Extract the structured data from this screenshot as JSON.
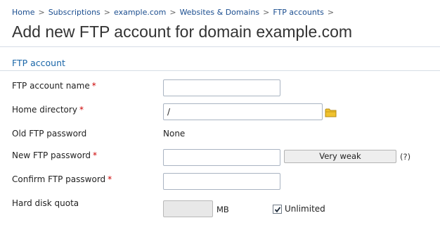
{
  "breadcrumb": {
    "items": [
      "Home",
      "Subscriptions",
      "example.com",
      "Websites & Domains",
      "FTP accounts"
    ],
    "separator": ">"
  },
  "page_title": "Add new FTP account for domain example.com",
  "section_title": "FTP account",
  "required_marker": "*",
  "form": {
    "account_name": {
      "label": "FTP account name",
      "value": ""
    },
    "home_directory": {
      "label": "Home directory",
      "value": "/"
    },
    "old_password": {
      "label": "Old FTP password",
      "value": "None"
    },
    "new_password": {
      "label": "New FTP password",
      "value": "",
      "strength": "Very weak",
      "help": "(?)"
    },
    "confirm_password": {
      "label": "Confirm FTP password",
      "value": ""
    },
    "disk_quota": {
      "label": "Hard disk quota",
      "value": "",
      "unit": "MB",
      "unlimited_label": "Unlimited",
      "unlimited_checked": true
    }
  },
  "icons": {
    "browse": "folder-icon"
  },
  "colors": {
    "link": "#1a4d8f",
    "section": "#1a66a8",
    "required": "#cc0000",
    "folder": "#f0c22e"
  }
}
